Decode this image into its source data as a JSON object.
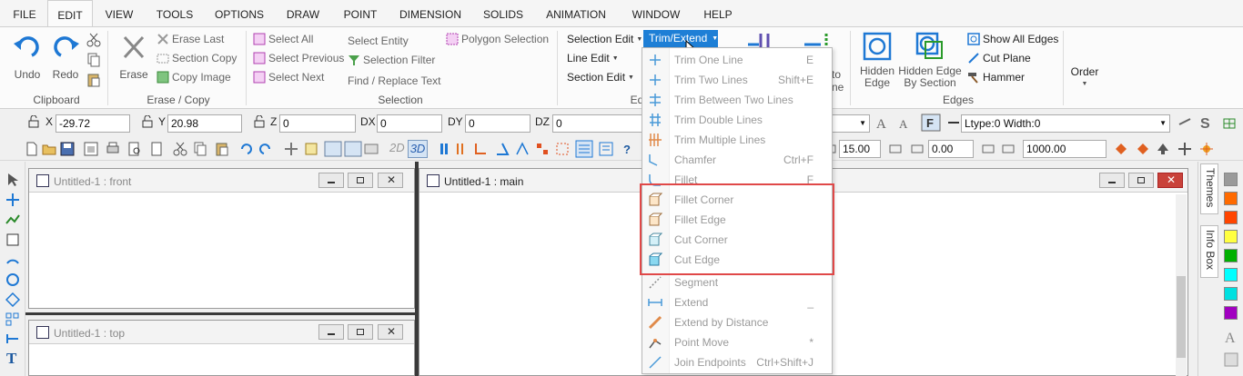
{
  "menu_tabs": [
    "FILE",
    "EDIT",
    "VIEW",
    "TOOLS",
    "OPTIONS",
    "DRAW",
    "POINT",
    "DIMENSION",
    "SOLIDS",
    "ANIMATION",
    "WINDOW",
    "HELP"
  ],
  "ribbon": {
    "clipboard": {
      "undo": "Undo",
      "redo": "Redo",
      "label": "Clipboard"
    },
    "erase": {
      "erase": "Erase",
      "erase_last": "Erase Last",
      "section_copy": "Section Copy",
      "copy_image": "Copy Image",
      "label": "Erase / Copy"
    },
    "selection": {
      "select_all": "Select All",
      "select_previous": "Select Previous",
      "select_next": "Select Next",
      "select_entity": "Select Entity",
      "selection_filter": "Selection Filter",
      "find_replace": "Find / Replace Text",
      "polygon_selection": "Polygon Selection",
      "label": "Selection"
    },
    "edit": {
      "selection_edit": "Selection Edit",
      "line_edit": "Line Edit",
      "section_edit": "Section Edit",
      "trim_extend": "Trim/Extend",
      "label_partial": "Ed"
    },
    "partial": {
      "to": "to",
      "ne": "ne"
    },
    "edges": {
      "hidden_edge": "Hidden Edge",
      "hidden_edge_by_section": "Hidden Edge By Section",
      "show_all_edges": "Show All Edges",
      "cut_plane": "Cut Plane",
      "hammer": "Hammer",
      "label": "Edges"
    },
    "order": "Order"
  },
  "coords": {
    "x_label": "X",
    "x_value": "-29.72",
    "y_label": "Y",
    "y_value": "20.98",
    "z_label": "Z",
    "z_value": "0",
    "dx_label": "DX",
    "dx_value": "0",
    "dy_label": "DY",
    "dy_value": "0",
    "dz_label": "DZ",
    "dz_value": "0"
  },
  "linetype": "Ltype:0  Width:0",
  "toolbar2": {
    "mode_2d": "2D",
    "mode_3d": "3D",
    "val1": "15.00",
    "val2": "0.00",
    "val3": "1000.00"
  },
  "viewports": {
    "front": "Untitled-1 : front",
    "top": "Untitled-1 : top",
    "main": "Untitled-1 : main"
  },
  "right_tabs": [
    "Themes",
    "Info Box"
  ],
  "palette_colors": [
    "#9a9a9a",
    "#ff6a00",
    "#ff4500",
    "#ffff40",
    "#00b000",
    "#00ffff",
    "#00e0e0",
    "#a000c0"
  ],
  "dropdown": {
    "items": [
      {
        "label": "Trim One Line",
        "shortcut": "E"
      },
      {
        "label": "Trim Two Lines",
        "shortcut": "Shift+E"
      },
      {
        "label": "Trim Between Two Lines",
        "shortcut": ""
      },
      {
        "label": "Trim Double Lines",
        "shortcut": ""
      },
      {
        "label": "Trim Multiple Lines",
        "shortcut": ""
      },
      {
        "label": "Chamfer",
        "shortcut": "Ctrl+F"
      },
      {
        "label": "Fillet",
        "shortcut": "F"
      },
      {
        "label": "Fillet Corner",
        "shortcut": ""
      },
      {
        "label": "Fillet Edge",
        "shortcut": ""
      },
      {
        "label": "Cut Corner",
        "shortcut": ""
      },
      {
        "label": "Cut Edge",
        "shortcut": ""
      },
      {
        "label": "Segment",
        "shortcut": ""
      },
      {
        "label": "Extend",
        "shortcut": "_"
      },
      {
        "label": "Extend by Distance",
        "shortcut": ""
      },
      {
        "label": "Point Move",
        "shortcut": "*"
      },
      {
        "label": "Join Endpoints",
        "shortcut": "Ctrl+Shift+J"
      }
    ]
  }
}
